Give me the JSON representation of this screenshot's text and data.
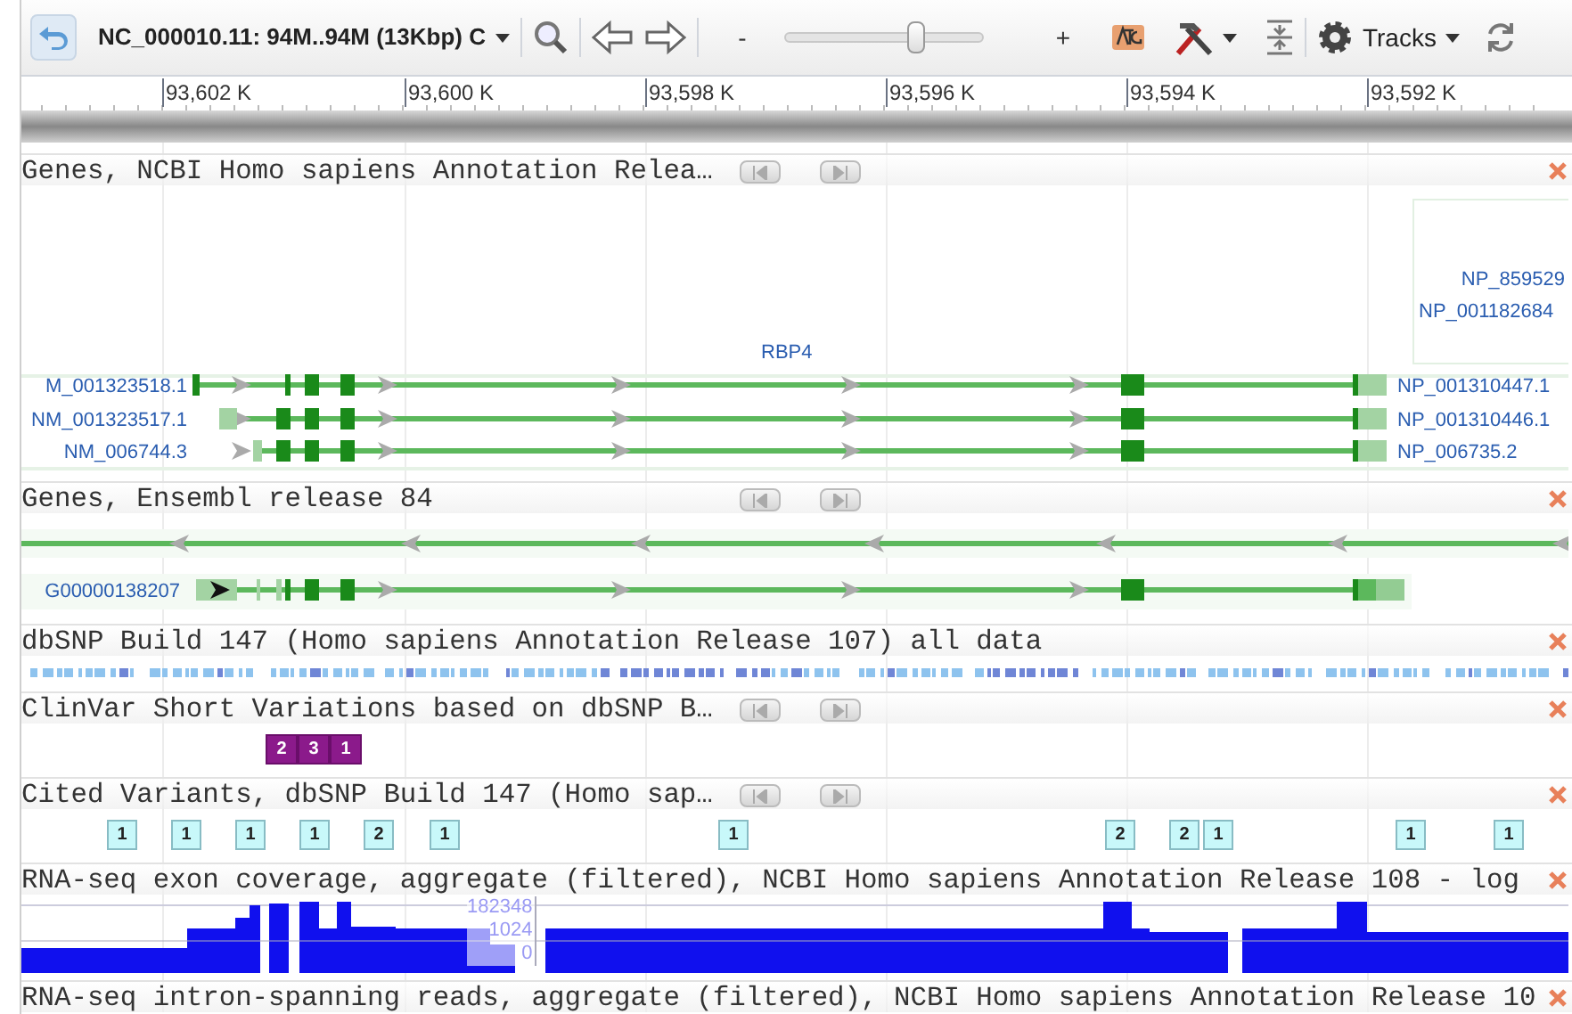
{
  "toolbar": {
    "location": "NC_000010.11: 94M..94M (13Kbp) C",
    "zoom_out": "-",
    "zoom_in": "+",
    "zoom": {
      "level": 0.66
    },
    "tracks_menu": "Tracks"
  },
  "ruler": {
    "ticks": [
      "93,602 K",
      "93,600 K",
      "93,598 K",
      "93,596 K",
      "93,594 K",
      "93,592 K"
    ]
  },
  "tracks": [
    {
      "kind": "genes",
      "title": "Genes, NCBI Homo sapiens Annotation Relea…",
      "nav_buttons": true,
      "closable": true,
      "gene_name": "RBP4",
      "protein_labels": [
        "NP_859529",
        "NP_001182684"
      ],
      "transcripts": [
        {
          "left": "M_001323518.1",
          "right": "NP_001310447.1"
        },
        {
          "left": "NM_001323517.1",
          "right": "NP_001310446.1"
        },
        {
          "left": "NM_006744.3",
          "right": "NP_006735.2"
        }
      ]
    },
    {
      "kind": "ensembl",
      "title": "Genes, Ensembl release 84",
      "nav_buttons": true,
      "closable": true,
      "transcript_label": "G00000138207"
    },
    {
      "kind": "snp",
      "title": "dbSNP Build 147 (Homo sapiens Annotation Release 107) all data",
      "nav_buttons": false,
      "closable": true
    },
    {
      "kind": "clinvar",
      "title": "ClinVar Short Variations based on dbSNP B…",
      "nav_buttons": true,
      "closable": true,
      "badges": [
        "2",
        "3",
        "1"
      ]
    },
    {
      "kind": "cited",
      "title": "Cited Variants, dbSNP Build 147 (Homo sap…",
      "nav_buttons": true,
      "closable": true,
      "badges": [
        "1",
        "1",
        "1",
        "1",
        "2",
        "1",
        "1",
        "2",
        "2",
        "1",
        "1",
        "1"
      ]
    },
    {
      "kind": "coverage",
      "title": "RNA-seq exon coverage, aggregate (filtered), NCBI Homo sapiens Annotation Release 108 - log",
      "nav_buttons": false,
      "closable": true,
      "scale_labels": [
        "182348",
        "1024",
        "0"
      ]
    },
    {
      "kind": "header_only",
      "title": "RNA-seq intron-spanning reads, aggregate (filtered), NCBI Homo sapiens Annotation Release 10",
      "nav_buttons": false,
      "closable": true
    }
  ]
}
